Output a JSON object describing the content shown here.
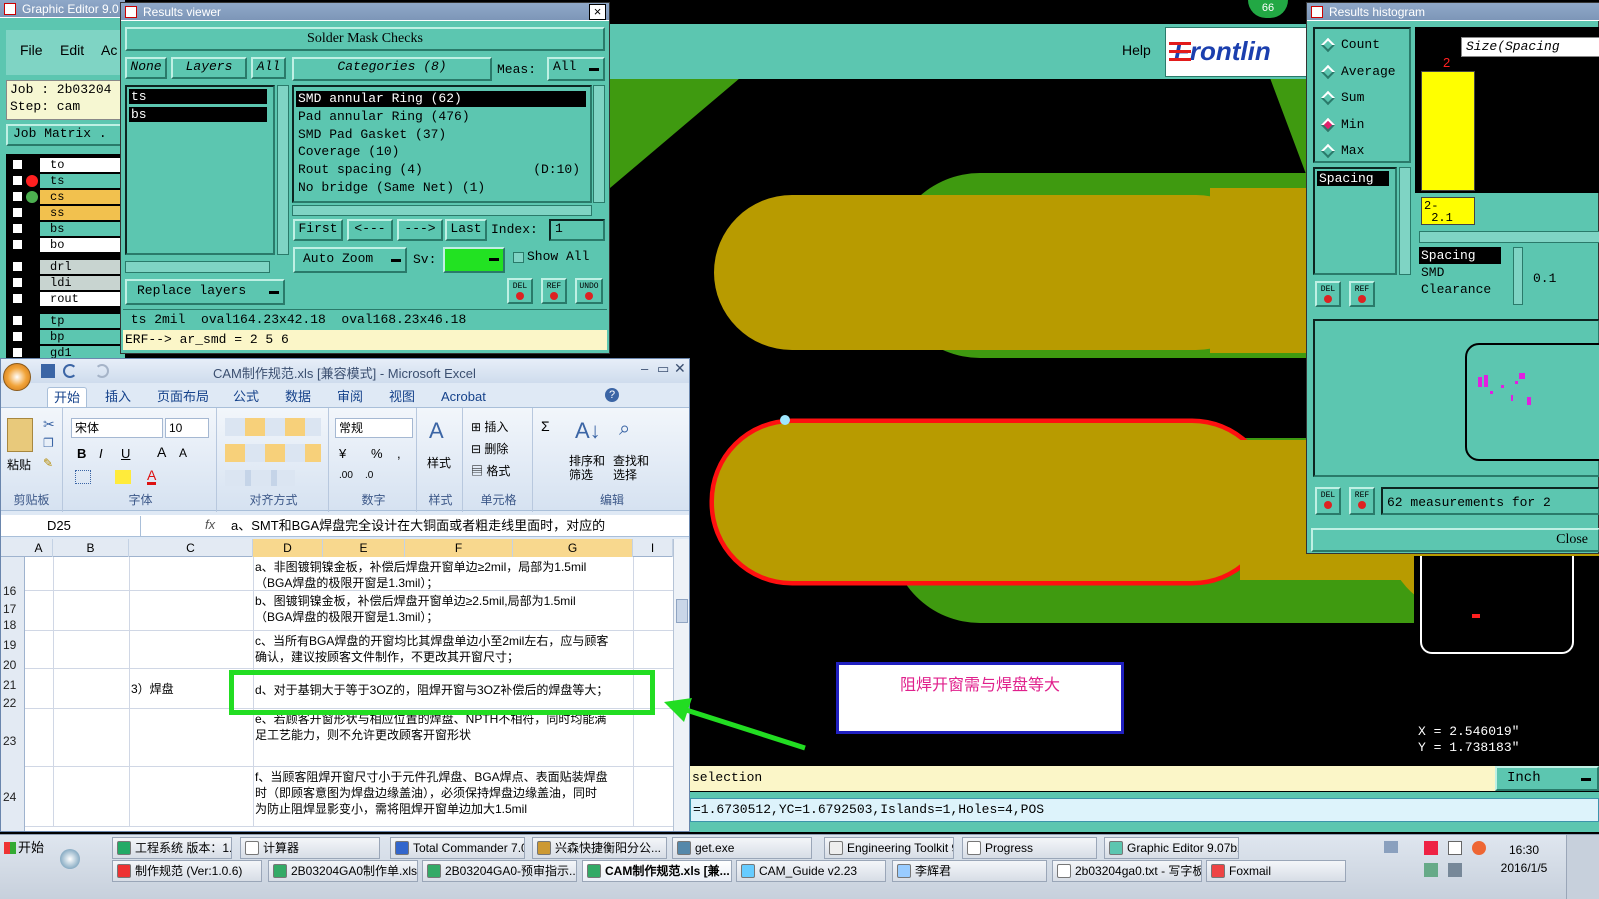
{
  "graphic_editor": {
    "title": "Graphic Editor 9.0",
    "menu": [
      "File",
      "Edit",
      "Ac"
    ],
    "help": "Help",
    "brand": "Frontlin",
    "job": "Job : 2b03204",
    "step": "Step: cam",
    "job_matrix": "Job Matrix .",
    "layers": [
      {
        "name": "to",
        "color": "#ffffff"
      },
      {
        "name": "ts",
        "color": "#5cc6b0"
      },
      {
        "name": "cs",
        "color": "#f2c14e"
      },
      {
        "name": "ss",
        "color": "#f2c14e"
      },
      {
        "name": "bs",
        "color": "#5cc6b0"
      },
      {
        "name": "bo",
        "color": "#ffffff"
      },
      {
        "name": "drl",
        "color": "#c8d4d0"
      },
      {
        "name": "ldi",
        "color": "#c8d4d0"
      },
      {
        "name": "rout",
        "color": "#ffffff"
      },
      {
        "name": "tp",
        "color": "#5cc6b0"
      },
      {
        "name": "bp",
        "color": "#5cc6b0"
      },
      {
        "name": "gd1",
        "color": "#5cc6b0"
      }
    ],
    "badge": "66",
    "selection_label": "selection",
    "status_line": "=1.6730512,YC=1.6792503,Islands=1,Holes=4,POS",
    "units": "Inch",
    "coord_x": "X = 2.546019\"",
    "coord_y": "Y = 1.738183\"",
    "annotation": "阻焊开窗需与焊盘等大"
  },
  "results_viewer": {
    "title": "Results viewer",
    "close": "×",
    "heading": "Solder Mask Checks",
    "btn_none": "None",
    "btn_layers": "Layers",
    "btn_all": "All",
    "categories_label": "Categories (8)",
    "meas_label": "Meas:",
    "meas_value": "All",
    "layer_list": [
      "ts",
      "bs"
    ],
    "categories": [
      {
        "text": "SMD annular Ring (62)",
        "extra": ""
      },
      {
        "text": "Pad annular Ring (476)",
        "extra": ""
      },
      {
        "text": "SMD Pad Gasket (37)",
        "extra": ""
      },
      {
        "text": "Coverage (10)",
        "extra": ""
      },
      {
        "text": "Rout spacing (4)",
        "extra": "(D:10)"
      },
      {
        "text": "No bridge (Same Net) (1)",
        "extra": ""
      }
    ],
    "nav": {
      "first": "First",
      "prev": "<---",
      "next": "--->",
      "last": "Last",
      "index_label": "Index:",
      "index_value": "1"
    },
    "auto_zoom": "Auto Zoom",
    "sv_label": "Sv:",
    "show_all": "Show All",
    "replace_layers": "Replace layers",
    "small_btns": [
      "DEL",
      "REF",
      "UNDO"
    ],
    "info_line": " ts 2mil  oval164.23x42.18  oval168.23x46.18",
    "erf_line": "ERF--> ar_smd = 2 5 6"
  },
  "histogram": {
    "title": "Results histogram",
    "options": [
      {
        "label": "Count",
        "selected": false
      },
      {
        "label": "Average",
        "selected": false
      },
      {
        "label": "Sum",
        "selected": false
      },
      {
        "label": "Min",
        "selected": true
      },
      {
        "label": "Max",
        "selected": false
      }
    ],
    "header_field": "Size(Spacing",
    "bar_label": "2",
    "range_label": "2-\n 2.1",
    "list_selected": "Spacing",
    "list2": [
      "Spacing",
      "SMD",
      "Clearance"
    ],
    "value": "0.1",
    "measurements": "62 measurements for 2",
    "close": "Close",
    "small_btns": [
      "DEL",
      "REF"
    ]
  },
  "excel": {
    "title": "CAM制作规范.xls [兼容模式] - Microsoft Excel",
    "tabs": [
      "开始",
      "插入",
      "页面布局",
      "公式",
      "数据",
      "审阅",
      "视图",
      "Acrobat"
    ],
    "groups": {
      "clipboard": "剪贴板",
      "font": "字体",
      "align": "对齐方式",
      "number": "数字",
      "style": "样式",
      "cells": "单元格",
      "edit": "编辑"
    },
    "paste": "粘贴",
    "font_name": "宋体",
    "font_size": "10",
    "number_format": "常规",
    "style_btn": "样式",
    "insert": "插入",
    "delete": "删除",
    "format": "格式",
    "sort": "排序和\n筛选",
    "find": "查找和\n选择",
    "name_box": "D25",
    "formula": "a、SMT和BGA焊盘完全设计在大铜面或者粗走线里面时，对应的",
    "columns": [
      "A",
      "B",
      "C",
      "D",
      "E",
      "F",
      "G",
      "I"
    ],
    "rows": [
      {
        "num": "16",
        "c": "",
        "d1": "a、非图镀铜镍金板，补偿后焊盘开窗单边≥2mil，局部为1.5mil",
        "d2": "（BGA焊盘的极限开窗是1.3mil）；"
      },
      {
        "num": "17",
        "c": "",
        "d1": "b、图镀铜镍金板，补偿后焊盘开窗单边≥2.5mil,局部为1.5mil",
        "d2": "（BGA焊盘的极限开窗是1.3mil）；"
      },
      {
        "num": "19",
        "c": "",
        "d1": "c、当所有BGA焊盘的开窗均比其焊盘单边小至2mil左右，应与顾客",
        "d2": "确认，建议按顾客文件制作，不更改其开窗尺寸；"
      },
      {
        "num": "21",
        "c": "3）焊盘",
        "d1": "d、对于基铜大于等于3OZ的，阻焊开窗与3OZ补偿后的焊盘等大；",
        "d2": ""
      },
      {
        "num": "23",
        "c": "",
        "d1": "e、若顾客开窗形状与相应位置的焊盘、NPTH不相符，同时均能满",
        "d2": "足工艺能力，则不允许更改顾客开窗形状"
      },
      {
        "num": "24",
        "c": "",
        "d1": "f、当顾客阻焊开窗尺寸小于元件孔焊盘、BGA焊点、表面贴装焊盘",
        "d2": "时（即顾客意图为焊盘边缘盖油），必须保持焊盘边缘盖油，同时",
        "d3": "为防止阻焊显影变小，需将阻焊开窗单边加大1.5mil"
      }
    ],
    "extra_row_nums": [
      "18",
      "20",
      "22"
    ]
  },
  "taskbar": {
    "start": "开始",
    "row1": [
      "工程系统  版本：1...",
      "计算器",
      "Total Commander 7.0 ...",
      "兴森快捷衡阳分公...",
      "get.exe",
      "Engineering Toolkit 9....",
      "Progress",
      "Graphic Editor 9.07b2..."
    ],
    "row2": [
      "制作规范 (Ver:1.0.6)",
      "2B03204GA0制作单.xls ...",
      "2B03204GA0-预审指示...",
      "CAM制作规范.xls [兼...",
      "CAM_Guide v2.23",
      "李辉君",
      "2b03204ga0.txt - 写字板",
      "Foxmail"
    ],
    "time": "16:30",
    "date": "2016/1/5"
  },
  "colors": {
    "teal": "#5cc6b0",
    "pcb_green": "#3f9a10",
    "pad_gold": "#b89b00",
    "highlight_red": "#ff1010",
    "annotation_blue": "#2020c0",
    "annotation_text": "#e0208c",
    "callout_green": "#22dd22"
  }
}
